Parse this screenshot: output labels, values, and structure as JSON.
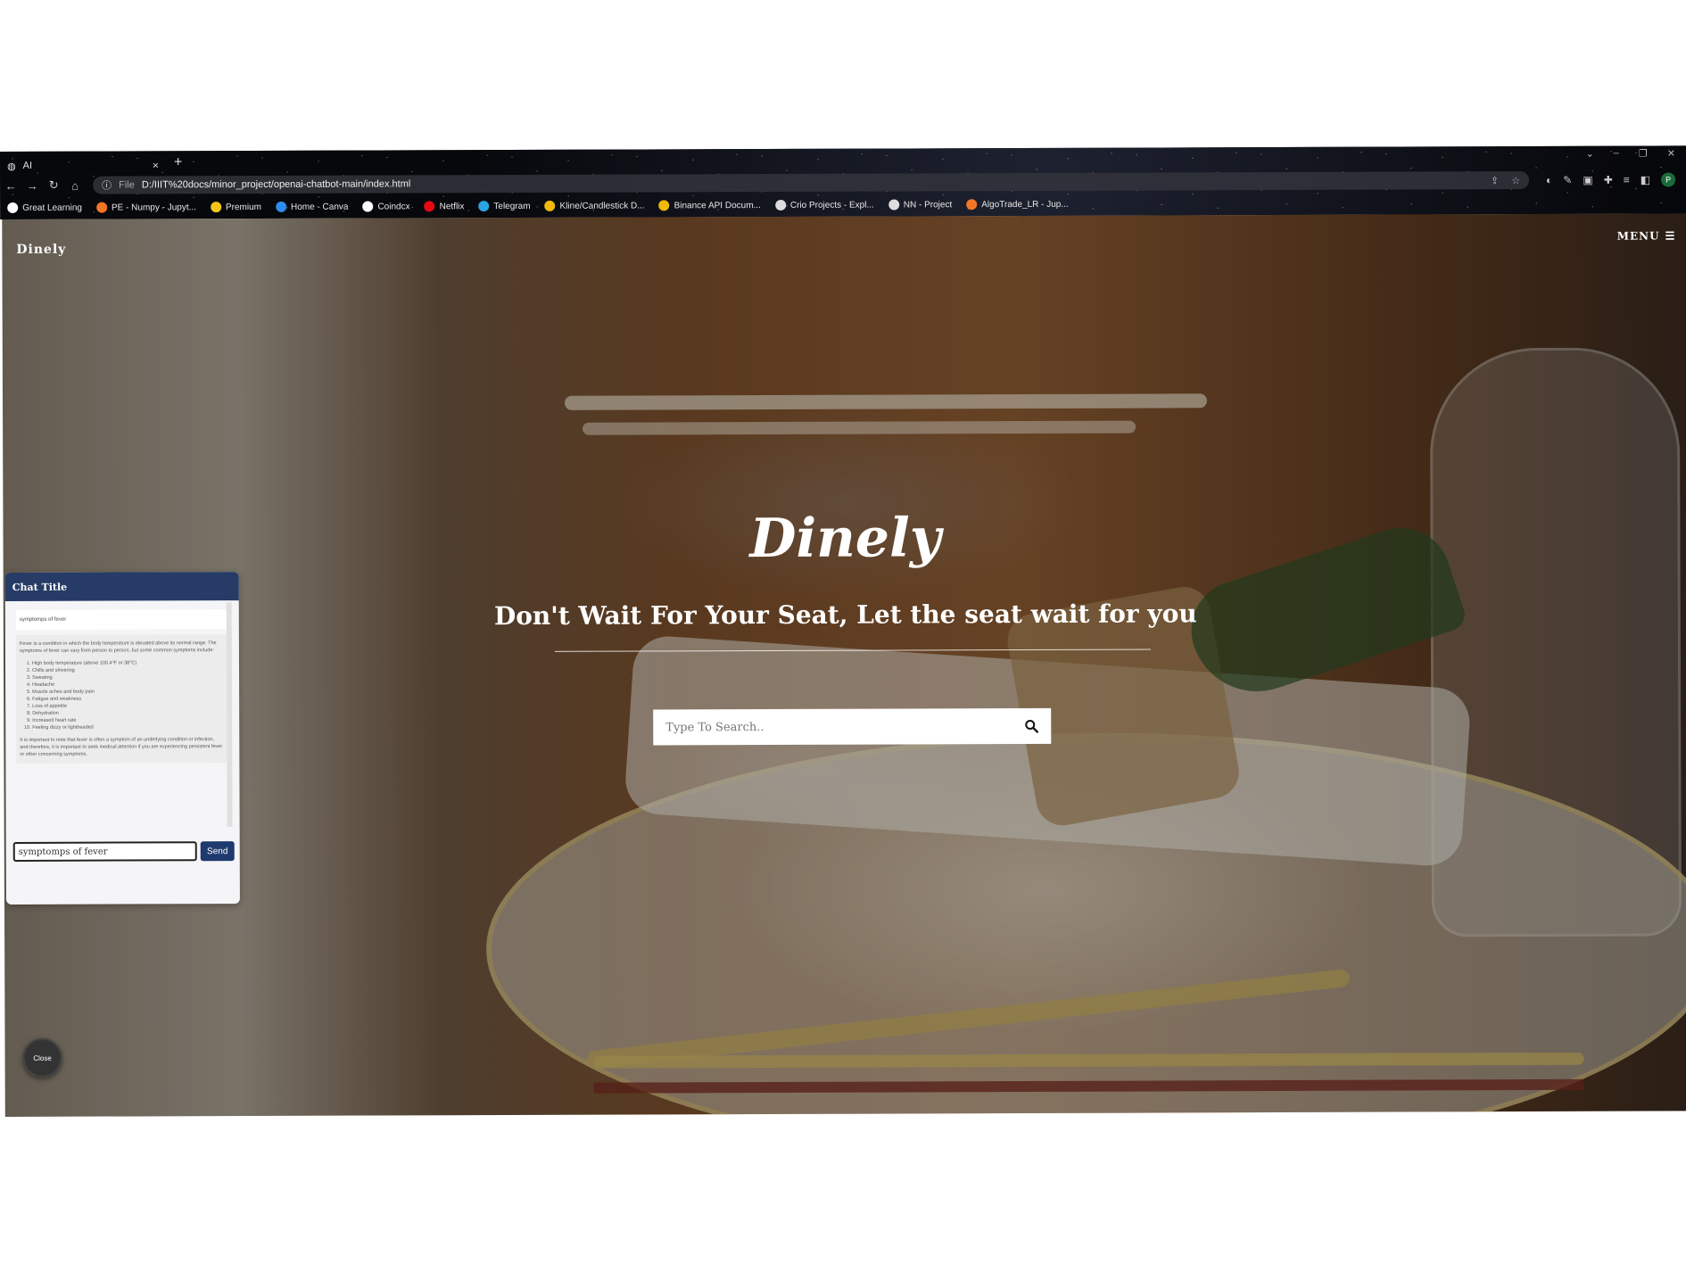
{
  "browser": {
    "tab_title": "AI",
    "tab_close": "×",
    "new_tab": "+",
    "file_label": "File",
    "url": "D:/IIIT%20docs/minor_project/openai-chatbot-main/index.html",
    "bookmarks": [
      {
        "label": "Great Learning",
        "color": "#ffffff"
      },
      {
        "label": "PE - Numpy - Jupyt...",
        "color": "#f37626"
      },
      {
        "label": "Premium",
        "color": "#f5c518"
      },
      {
        "label": "Home - Canva",
        "color": "#2d8cf0"
      },
      {
        "label": "Coindcx",
        "color": "#ffffff"
      },
      {
        "label": "Netflix",
        "color": "#e50914"
      },
      {
        "label": "Telegram",
        "color": "#2aa3e0"
      },
      {
        "label": "Kline/Candlestick D...",
        "color": "#f0b90b"
      },
      {
        "label": "Binance API Docum...",
        "color": "#f0b90b"
      },
      {
        "label": "Crio Projects - Expl...",
        "color": "#dddddd"
      },
      {
        "label": "NN - Project",
        "color": "#dddddd"
      },
      {
        "label": "AlgoTrade_LR - Jup...",
        "color": "#f37626"
      }
    ],
    "profile_initial": "P"
  },
  "site": {
    "brand": "Dinely",
    "menu_label": "MENU",
    "title": "Dinely",
    "tagline": "Don't Wait For Your Seat, Let the seat wait for you",
    "search_placeholder": "Type To Search.."
  },
  "chat": {
    "title": "Chat Title",
    "user_message": "symptomps of fever",
    "bot_intro": "Fever is a condition in which the body temperature is elevated above its normal range. The symptoms of fever can vary from person to person, but some common symptoms include:",
    "bot_list": [
      "High body temperature (above 100.4°F or 38°C)",
      "Chills and shivering",
      "Sweating",
      "Headache",
      "Muscle aches and body pain",
      "Fatigue and weakness",
      "Loss of appetite",
      "Dehydration",
      "Increased heart rate",
      "Feeling dizzy or lightheaded"
    ],
    "bot_outro": "It is important to note that fever is often a symptom of an underlying condition or infection, and therefore, it is important to seek medical attention if you are experiencing persistent fever or other concerning symptoms.",
    "input_value": "symptomps of fever",
    "send_label": "Send",
    "close_label": "Close"
  },
  "colors": {
    "chat_header": "#263b66",
    "send_button": "#1f3a6e"
  }
}
